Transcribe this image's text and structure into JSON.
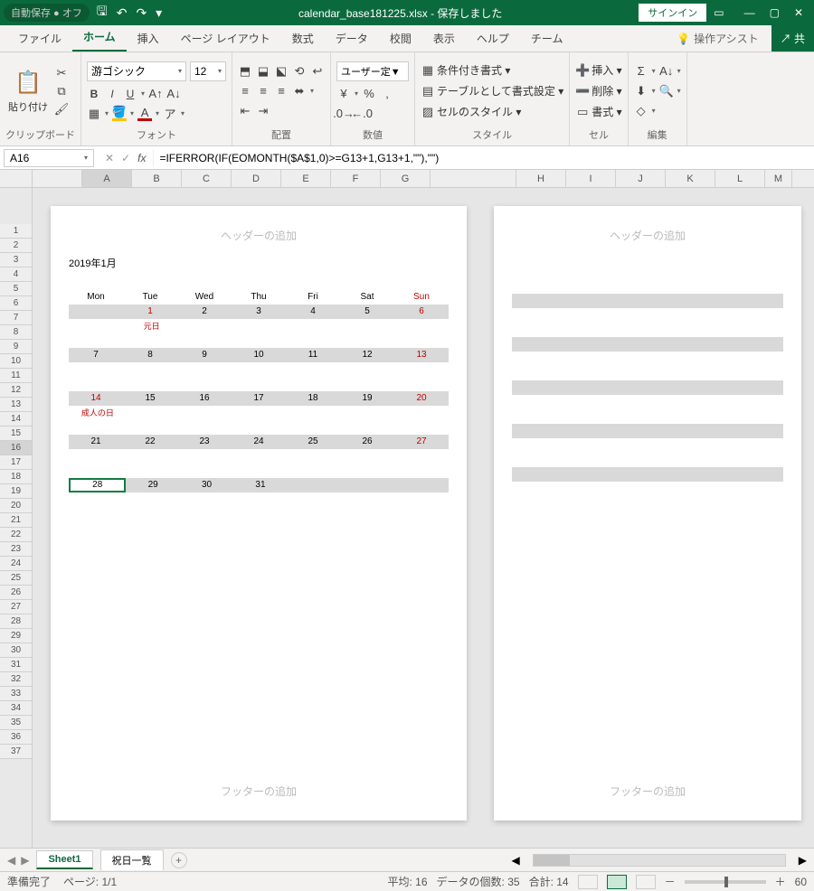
{
  "title": {
    "autosave": "自動保存 ● オフ",
    "doc": "calendar_base181225.xlsx - 保存しました",
    "signin": "サインイン"
  },
  "tabs": {
    "file": "ファイル",
    "home": "ホーム",
    "insert": "挿入",
    "layout": "ページ レイアウト",
    "formulas": "数式",
    "data": "データ",
    "review": "校閲",
    "view": "表示",
    "help": "ヘルプ",
    "team": "チーム",
    "tellme": "操作アシスト",
    "share": "共"
  },
  "ribbon": {
    "clipboard": {
      "label": "クリップボード",
      "paste": "貼り付け"
    },
    "font": {
      "label": "フォント",
      "name": "游ゴシック",
      "size": "12"
    },
    "align": {
      "label": "配置"
    },
    "number": {
      "label": "数値",
      "format": "ユーザー定▼"
    },
    "styles": {
      "label": "スタイル",
      "cond": "条件付き書式 ▾",
      "table": "テーブルとして書式設定 ▾",
      "cell": "セルのスタイル ▾"
    },
    "cells": {
      "label": "セル",
      "insert": "挿入 ▾",
      "delete": "削除 ▾",
      "format": "書式 ▾"
    },
    "editing": {
      "label": "編集"
    }
  },
  "formula": {
    "cell": "A16",
    "text": "=IFERROR(IF(EOMONTH($A$1,0)>=G13+1,G13+1,\"\"),\"\")"
  },
  "cols": [
    "A",
    "B",
    "C",
    "D",
    "E",
    "F",
    "G",
    "",
    "H",
    "I",
    "J",
    "K",
    "L",
    "M"
  ],
  "rows": [
    "1",
    "2",
    "3",
    "4",
    "5",
    "6",
    "7",
    "8",
    "9",
    "10",
    "11",
    "12",
    "13",
    "14",
    "15",
    "16",
    "17",
    "18",
    "19",
    "20",
    "21",
    "22",
    "23",
    "24",
    "25",
    "26",
    "27",
    "28",
    "29",
    "30",
    "31",
    "32",
    "33",
    "34",
    "35",
    "36",
    "37"
  ],
  "page": {
    "header": "ヘッダーの追加",
    "footer": "フッターの追加"
  },
  "cal": {
    "title": "2019年1月",
    "days": [
      "Mon",
      "Tue",
      "Wed",
      "Thu",
      "Fri",
      "Sat",
      "Sun"
    ],
    "w1": [
      "",
      "1",
      "2",
      "3",
      "4",
      "5",
      "6"
    ],
    "n1": [
      "",
      "元日",
      "",
      "",
      "",
      "",
      ""
    ],
    "w2": [
      "7",
      "8",
      "9",
      "10",
      "11",
      "12",
      "13"
    ],
    "w3": [
      "14",
      "15",
      "16",
      "17",
      "18",
      "19",
      "20"
    ],
    "n3": [
      "成人の日",
      "",
      "",
      "",
      "",
      "",
      ""
    ],
    "w4": [
      "21",
      "22",
      "23",
      "24",
      "25",
      "26",
      "27"
    ],
    "w5": [
      "28",
      "29",
      "30",
      "31",
      "",
      "",
      ""
    ]
  },
  "sheets": {
    "s1": "Sheet1",
    "s2": "祝日一覧"
  },
  "status": {
    "ready": "準備完了",
    "page": "ページ: 1/1",
    "avg": "平均: 16",
    "count": "データの個数: 35",
    "sum": "合計: 14",
    "zoom": "60"
  }
}
